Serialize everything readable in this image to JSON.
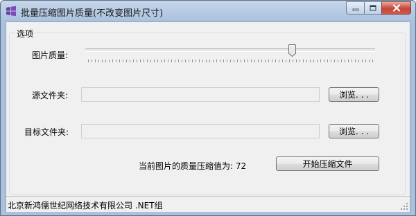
{
  "window": {
    "title": "批量压缩图片质量(不改变图片尺寸)",
    "colors": {
      "title_bar": "#aac1de",
      "close_button": "#c4463a",
      "client_bg": "#f0f0f0"
    }
  },
  "options_group": {
    "label": "选项",
    "quality_label": "图片质量:",
    "quality_value": 72,
    "quality_min": 0,
    "quality_max": 100,
    "source_folder_label": "源文件夹:",
    "source_folder_value": "",
    "browse_source_label": "浏览. . .",
    "target_folder_label": "目标文件夹:",
    "target_folder_value": "",
    "browse_target_label": "浏览. . .",
    "current_quality_text": "当前图片的质量压缩值为: 72",
    "start_button_label": "开始压缩文件"
  },
  "status_bar": {
    "text": "北京新鸿儒世纪网络技术有限公司 .NET组"
  },
  "icons": [
    "windows-logo-icon",
    "minimize-icon",
    "maximize-icon",
    "close-icon",
    "size-grip-icon"
  ]
}
